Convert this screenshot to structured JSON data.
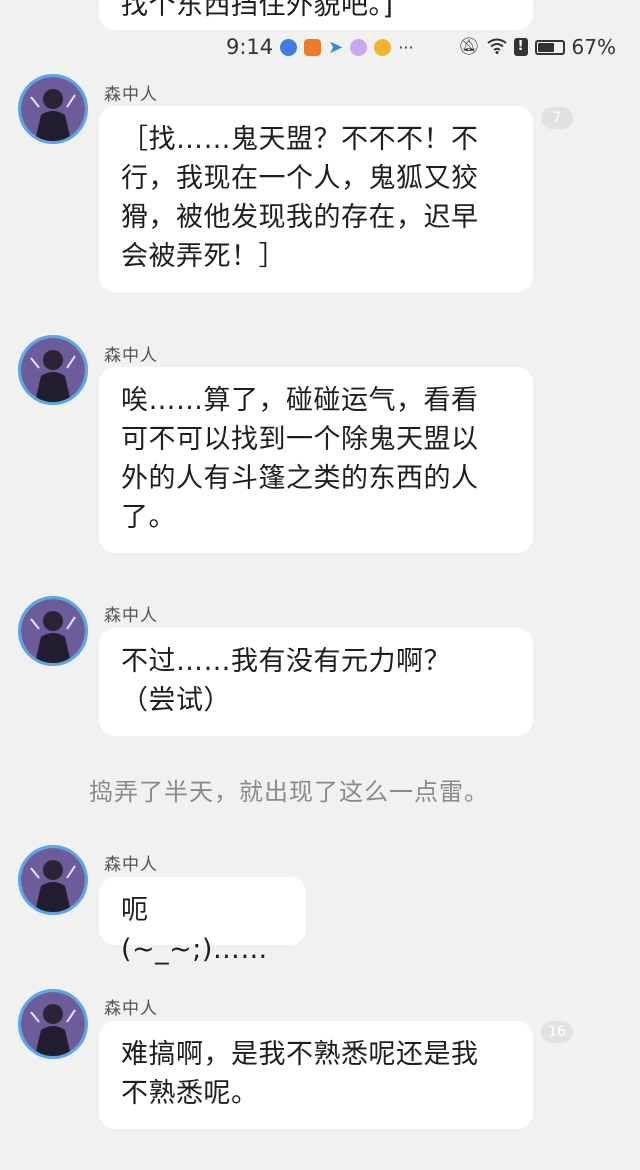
{
  "status_bar": {
    "time": "9:14",
    "more": "···",
    "battery_percent": "67%",
    "battery_level": 0.67,
    "app_icons": [
      "music-icon",
      "video-icon",
      "send-icon",
      "circle-app-icon",
      "weibo-icon"
    ],
    "system_icons": [
      "mute-bell-icon",
      "wifi-icon",
      "alert-icon",
      "battery-icon"
    ]
  },
  "top_bubble": {
    "text": "找个东西挡住外貌吧。]"
  },
  "messages": [
    {
      "sender": "森中人",
      "lines": [
        "［找……鬼天盟？不不不！不",
        "行，我现在一个人，鬼狐又狡",
        "猾，被他发现我的存在，迟早",
        "会被弄死！］"
      ],
      "badge": "7"
    },
    {
      "sender": "森中人",
      "lines": [
        "唉……算了，碰碰运气，看看",
        "可不可以找到一个除鬼天盟以",
        "外的人有斗篷之类的东西的人",
        "了。"
      ]
    },
    {
      "sender": "森中人",
      "lines": [
        "不过……我有没有元力啊？",
        "（尝试）"
      ]
    },
    {
      "sender": "森中人",
      "lines": [
        "呃(~_~;)……"
      ]
    },
    {
      "sender": "森中人",
      "lines": [
        "难搞啊，是我不熟悉呢还是我",
        "不熟悉呢。"
      ],
      "badge": "16"
    }
  ],
  "system_message": "捣弄了半天，就出现了这么一点雷。",
  "colors": {
    "background": "#f1f1f1",
    "bubble": "#ffffff",
    "avatar_ring": "#5aa6e6",
    "badge": "#e2e2e2"
  }
}
